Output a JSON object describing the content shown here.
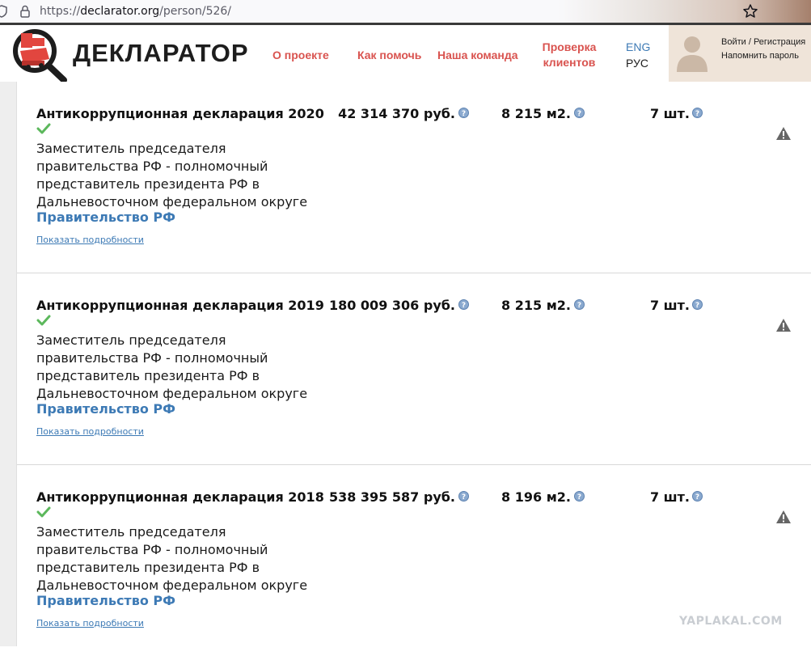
{
  "browser": {
    "url_prefix": "https://",
    "url_host": "declarator.org",
    "url_path": "/person/526/"
  },
  "header": {
    "logo_text": "ДЕКЛАРАТОР",
    "nav": {
      "about": "О проекте",
      "help": "Как помочь",
      "team": "Наша команда",
      "check_line1": "Проверка",
      "check_line2": "клиентов"
    },
    "lang": {
      "eng": "ENG",
      "rus": "РУС"
    },
    "user": {
      "login": "Войти / Регистрация",
      "remind": "Напомнить пароль"
    }
  },
  "declarations": [
    {
      "title": "Антикоррупционная декларация 2020",
      "position": "Заместитель председателя правительства РФ - полномочный представитель президента РФ в Дальневосточном федеральном округе",
      "organization": "Правительство РФ",
      "details": "Показать подробности",
      "income": "42 314 370 руб.",
      "area": "8 215 м2.",
      "vehicles": "7 шт."
    },
    {
      "title": "Антикоррупционная декларация 2019",
      "position": "Заместитель председателя правительства РФ - полномочный представитель президента РФ в Дальневосточном федеральном округе",
      "organization": "Правительство РФ",
      "details": "Показать подробности",
      "income": "180 009 306 руб.",
      "area": "8 215 м2.",
      "vehicles": "7 шт."
    },
    {
      "title": "Антикоррупционная декларация 2018",
      "position": "Заместитель председателя правительства РФ - полномочный представитель президента РФ в Дальневосточном федеральном округе",
      "organization": "Правительство РФ",
      "details": "Показать подробности",
      "income": "538 395 587 руб.",
      "area": "8 196 м2.",
      "vehicles": "7 шт."
    }
  ],
  "watermark": "YAPLAKAL.COM",
  "colors": {
    "accent_red": "#d9534f",
    "link_blue": "#3d7ab5",
    "check_green": "#5cb85c"
  },
  "icons": [
    "shield-icon",
    "lock-icon",
    "star-icon",
    "logo-magnifier-icon",
    "avatar-icon",
    "check-icon",
    "help-icon",
    "warning-icon"
  ]
}
